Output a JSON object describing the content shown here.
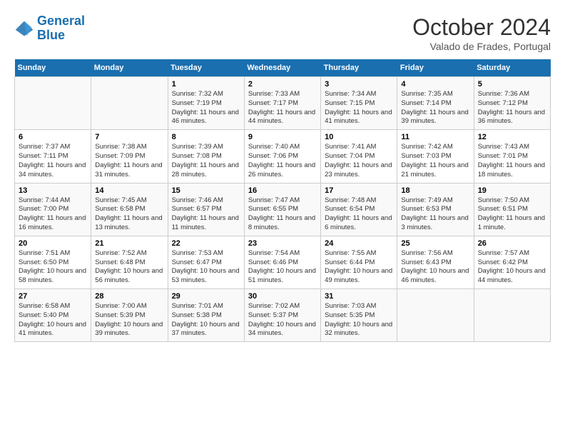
{
  "header": {
    "logo_line1": "General",
    "logo_line2": "Blue",
    "month": "October 2024",
    "location": "Valado de Frades, Portugal"
  },
  "weekdays": [
    "Sunday",
    "Monday",
    "Tuesday",
    "Wednesday",
    "Thursday",
    "Friday",
    "Saturday"
  ],
  "weeks": [
    [
      {
        "day": "",
        "info": ""
      },
      {
        "day": "",
        "info": ""
      },
      {
        "day": "1",
        "info": "Sunrise: 7:32 AM\nSunset: 7:19 PM\nDaylight: 11 hours and 46 minutes."
      },
      {
        "day": "2",
        "info": "Sunrise: 7:33 AM\nSunset: 7:17 PM\nDaylight: 11 hours and 44 minutes."
      },
      {
        "day": "3",
        "info": "Sunrise: 7:34 AM\nSunset: 7:15 PM\nDaylight: 11 hours and 41 minutes."
      },
      {
        "day": "4",
        "info": "Sunrise: 7:35 AM\nSunset: 7:14 PM\nDaylight: 11 hours and 39 minutes."
      },
      {
        "day": "5",
        "info": "Sunrise: 7:36 AM\nSunset: 7:12 PM\nDaylight: 11 hours and 36 minutes."
      }
    ],
    [
      {
        "day": "6",
        "info": "Sunrise: 7:37 AM\nSunset: 7:11 PM\nDaylight: 11 hours and 34 minutes."
      },
      {
        "day": "7",
        "info": "Sunrise: 7:38 AM\nSunset: 7:09 PM\nDaylight: 11 hours and 31 minutes."
      },
      {
        "day": "8",
        "info": "Sunrise: 7:39 AM\nSunset: 7:08 PM\nDaylight: 11 hours and 28 minutes."
      },
      {
        "day": "9",
        "info": "Sunrise: 7:40 AM\nSunset: 7:06 PM\nDaylight: 11 hours and 26 minutes."
      },
      {
        "day": "10",
        "info": "Sunrise: 7:41 AM\nSunset: 7:04 PM\nDaylight: 11 hours and 23 minutes."
      },
      {
        "day": "11",
        "info": "Sunrise: 7:42 AM\nSunset: 7:03 PM\nDaylight: 11 hours and 21 minutes."
      },
      {
        "day": "12",
        "info": "Sunrise: 7:43 AM\nSunset: 7:01 PM\nDaylight: 11 hours and 18 minutes."
      }
    ],
    [
      {
        "day": "13",
        "info": "Sunrise: 7:44 AM\nSunset: 7:00 PM\nDaylight: 11 hours and 16 minutes."
      },
      {
        "day": "14",
        "info": "Sunrise: 7:45 AM\nSunset: 6:58 PM\nDaylight: 11 hours and 13 minutes."
      },
      {
        "day": "15",
        "info": "Sunrise: 7:46 AM\nSunset: 6:57 PM\nDaylight: 11 hours and 11 minutes."
      },
      {
        "day": "16",
        "info": "Sunrise: 7:47 AM\nSunset: 6:55 PM\nDaylight: 11 hours and 8 minutes."
      },
      {
        "day": "17",
        "info": "Sunrise: 7:48 AM\nSunset: 6:54 PM\nDaylight: 11 hours and 6 minutes."
      },
      {
        "day": "18",
        "info": "Sunrise: 7:49 AM\nSunset: 6:53 PM\nDaylight: 11 hours and 3 minutes."
      },
      {
        "day": "19",
        "info": "Sunrise: 7:50 AM\nSunset: 6:51 PM\nDaylight: 11 hours and 1 minute."
      }
    ],
    [
      {
        "day": "20",
        "info": "Sunrise: 7:51 AM\nSunset: 6:50 PM\nDaylight: 10 hours and 58 minutes."
      },
      {
        "day": "21",
        "info": "Sunrise: 7:52 AM\nSunset: 6:48 PM\nDaylight: 10 hours and 56 minutes."
      },
      {
        "day": "22",
        "info": "Sunrise: 7:53 AM\nSunset: 6:47 PM\nDaylight: 10 hours and 53 minutes."
      },
      {
        "day": "23",
        "info": "Sunrise: 7:54 AM\nSunset: 6:46 PM\nDaylight: 10 hours and 51 minutes."
      },
      {
        "day": "24",
        "info": "Sunrise: 7:55 AM\nSunset: 6:44 PM\nDaylight: 10 hours and 49 minutes."
      },
      {
        "day": "25",
        "info": "Sunrise: 7:56 AM\nSunset: 6:43 PM\nDaylight: 10 hours and 46 minutes."
      },
      {
        "day": "26",
        "info": "Sunrise: 7:57 AM\nSunset: 6:42 PM\nDaylight: 10 hours and 44 minutes."
      }
    ],
    [
      {
        "day": "27",
        "info": "Sunrise: 6:58 AM\nSunset: 5:40 PM\nDaylight: 10 hours and 41 minutes."
      },
      {
        "day": "28",
        "info": "Sunrise: 7:00 AM\nSunset: 5:39 PM\nDaylight: 10 hours and 39 minutes."
      },
      {
        "day": "29",
        "info": "Sunrise: 7:01 AM\nSunset: 5:38 PM\nDaylight: 10 hours and 37 minutes."
      },
      {
        "day": "30",
        "info": "Sunrise: 7:02 AM\nSunset: 5:37 PM\nDaylight: 10 hours and 34 minutes."
      },
      {
        "day": "31",
        "info": "Sunrise: 7:03 AM\nSunset: 5:35 PM\nDaylight: 10 hours and 32 minutes."
      },
      {
        "day": "",
        "info": ""
      },
      {
        "day": "",
        "info": ""
      }
    ]
  ]
}
